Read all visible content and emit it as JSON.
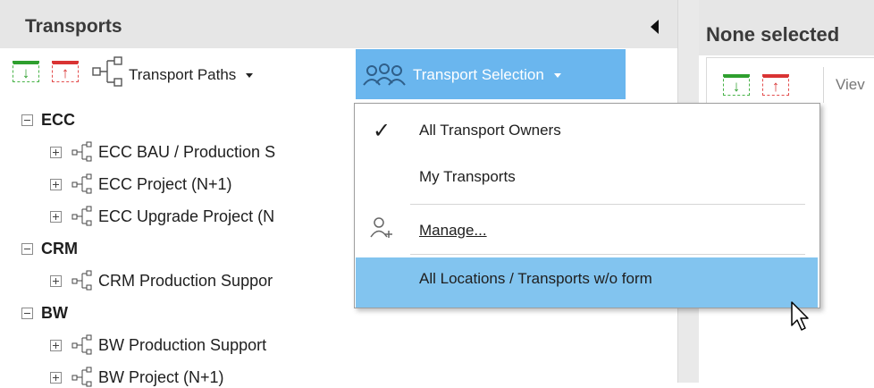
{
  "left_panel": {
    "title": "Transports",
    "toolbar": {
      "transport_paths_label": "Transport Paths",
      "transport_selection_label": "Transport Selection"
    },
    "tree": [
      {
        "label": "ECC",
        "children": [
          "ECC BAU / Production S",
          "ECC Project (N+1)",
          "ECC Upgrade Project (N"
        ]
      },
      {
        "label": "CRM",
        "children": [
          "CRM Production Suppor"
        ]
      },
      {
        "label": "BW",
        "children": [
          "BW Production Support",
          "BW Project (N+1)"
        ]
      }
    ]
  },
  "right_panel": {
    "title": "None selected",
    "toolbar": {
      "view_label": "Viev"
    }
  },
  "dropdown": {
    "items": [
      {
        "label": "All Transport Owners",
        "checked": true
      },
      {
        "label": "My Transports"
      },
      {
        "label": "Manage..."
      },
      {
        "label": "All Locations / Transports w/o form",
        "highlighted": true
      }
    ]
  },
  "colors": {
    "accent": "#6ab6ee",
    "menu_highlight": "#82c4ef",
    "header_bg": "#e6e6e6",
    "import_green": "#2e9f2e",
    "export_red": "#d93333"
  },
  "icons": {
    "collapse": "collapse-left-icon",
    "import": "import-icon",
    "export": "export-icon",
    "paths": "transport-path-icon",
    "users": "users-icon",
    "check": "checkmark-icon",
    "manage": "manage-user-icon",
    "cursor": "mouse-cursor-icon"
  }
}
